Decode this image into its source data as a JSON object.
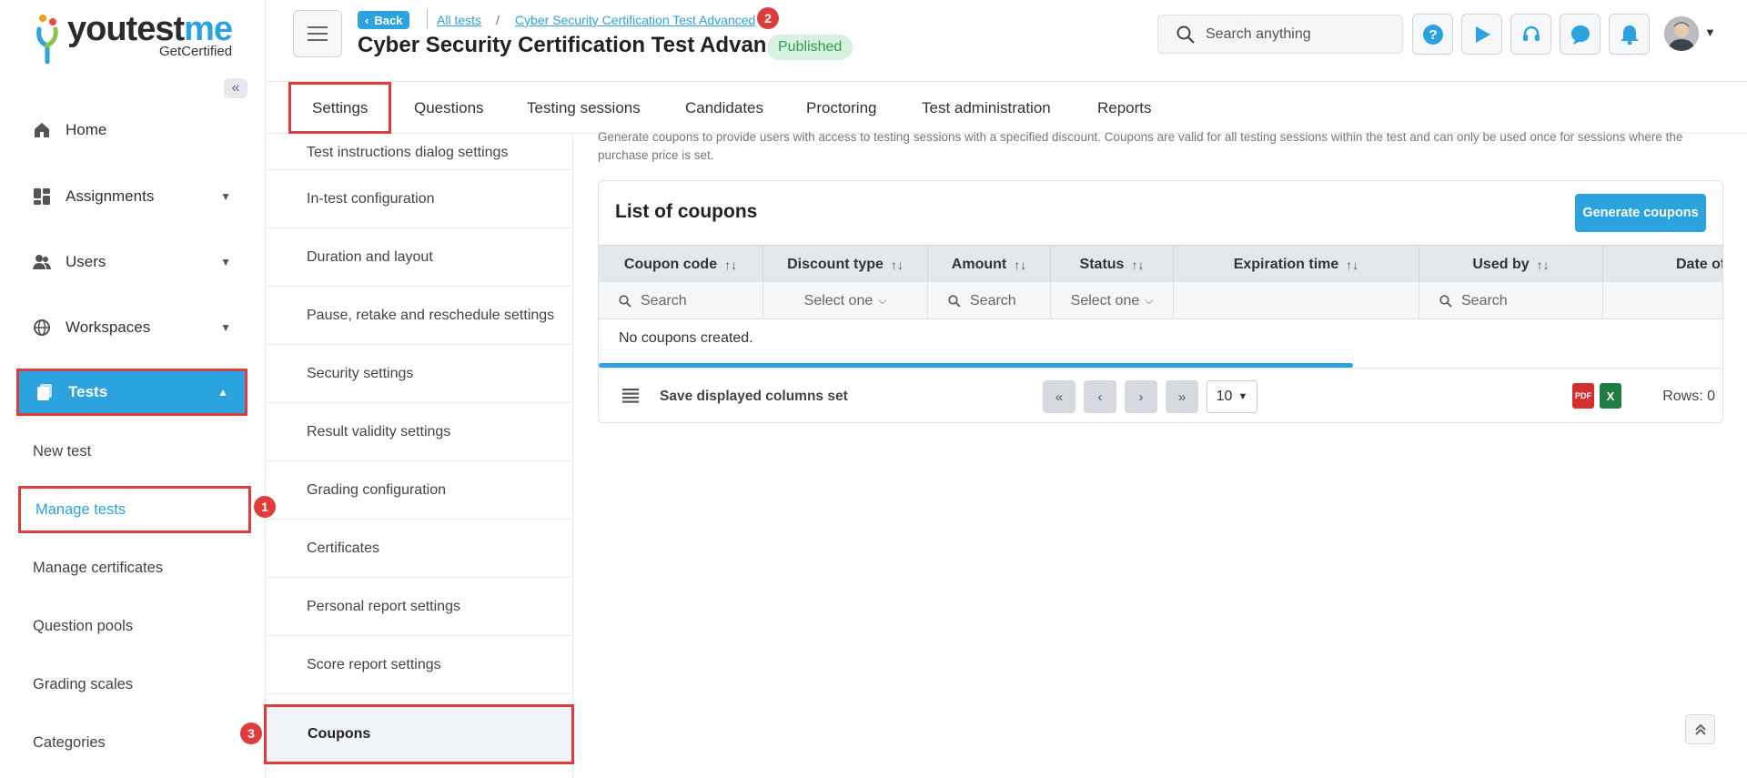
{
  "brand": {
    "logo_main": "youtest",
    "logo_accent": "me",
    "logo_sub": "GetCertified",
    "accent_color": "#2aa3df",
    "highlight_color": "#e03c3c"
  },
  "sidebar": {
    "collapse_icon": "double-chevron-left-icon",
    "items": [
      {
        "label": "Home",
        "icon": "home-icon"
      },
      {
        "label": "Assignments",
        "icon": "dashboard-icon"
      },
      {
        "label": "Users",
        "icon": "users-icon"
      },
      {
        "label": "Workspaces",
        "icon": "globe-icon"
      },
      {
        "label": "Tests",
        "icon": "tests-icon"
      }
    ],
    "sub_items": [
      {
        "label": "New test"
      },
      {
        "label": "Manage tests"
      },
      {
        "label": "Manage certificates"
      },
      {
        "label": "Question pools"
      },
      {
        "label": "Grading scales"
      },
      {
        "label": "Categories"
      }
    ]
  },
  "annotations": {
    "step1": "1",
    "step2": "2",
    "step3": "3"
  },
  "header": {
    "back_label": "Back",
    "breadcrumb_all": "All tests",
    "breadcrumb_sep": "/",
    "breadcrumb_current": "Cyber Security Certification Test Advanced",
    "title": "Cyber Security Certification Test Advanced",
    "status": "Published",
    "search_placeholder": "Search anything"
  },
  "tabs": [
    {
      "label": "Settings"
    },
    {
      "label": "Questions"
    },
    {
      "label": "Testing sessions"
    },
    {
      "label": "Candidates"
    },
    {
      "label": "Proctoring"
    },
    {
      "label": "Test administration"
    },
    {
      "label": "Reports"
    }
  ],
  "settings_menu": [
    {
      "label": "Test instructions dialog settings"
    },
    {
      "label": "In-test configuration"
    },
    {
      "label": "Duration and layout"
    },
    {
      "label": "Pause, retake and reschedule settings"
    },
    {
      "label": "Security settings"
    },
    {
      "label": "Result validity settings"
    },
    {
      "label": "Grading configuration"
    },
    {
      "label": "Certificates"
    },
    {
      "label": "Personal report settings"
    },
    {
      "label": "Score report settings"
    },
    {
      "label": "Coupons"
    }
  ],
  "coupons": {
    "description": "Generate coupons to provide users with access to testing sessions with a specified discount. Coupons are valid for all testing sessions within the test and can only be used once for sessions where the purchase price is set.",
    "title": "List of coupons",
    "generate_label": "Generate coupons",
    "columns": [
      "Coupon code",
      "Discount type",
      "Amount",
      "Status",
      "Expiration time",
      "Used by",
      "Date of"
    ],
    "filters": {
      "search": "Search",
      "select": "Select one"
    },
    "empty_message": "No coupons created.",
    "progress_fraction": 0.67,
    "save_columns_label": "Save displayed columns set",
    "page_size": "10",
    "rows_label": "Rows: 0",
    "pdf_label": "PDF",
    "xls_label": "X"
  }
}
